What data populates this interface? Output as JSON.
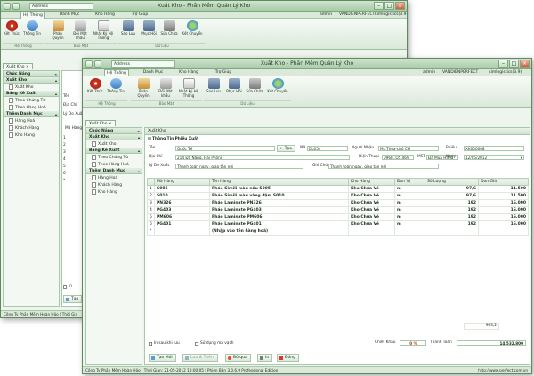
{
  "window": {
    "title": "Xuất Kho - Phần Mềm Quản Lý Kho",
    "address_label": "Address"
  },
  "menu": {
    "tabs": [
      "Hệ Thống",
      "Danh Mục",
      "Kho Hàng",
      "Trợ Giúp"
    ],
    "user": "admin",
    "machine": "VANDIENPERFECT",
    "company": "kimlogistics(3.9)"
  },
  "ribbon": {
    "system_buttons": [
      {
        "label": "Kết Thúc",
        "icon": "power-icon"
      },
      {
        "label": "Thông Tin",
        "icon": "info-icon"
      },
      {
        "label": "Phân Quyền",
        "icon": "users-icon"
      },
      {
        "label": "Đổi Mật khẩu",
        "icon": "password-icon"
      },
      {
        "label": "Nhật Ký Hệ Thống",
        "icon": "log-icon"
      }
    ],
    "data_buttons": [
      {
        "label": "Sao Lưu",
        "icon": "backup-icon"
      },
      {
        "label": "Phục Hồi",
        "icon": "restore-icon"
      },
      {
        "label": "Sửa Chữa",
        "icon": "repair-icon"
      },
      {
        "label": "Kết Chuyển",
        "icon": "transfer-icon"
      }
    ],
    "groups": [
      "Hệ Thống",
      "Bảo Mật",
      "Dữ Liệu"
    ]
  },
  "document_tab": "Xuất Kho",
  "sidebar": {
    "sections": [
      {
        "title": "Chức Năng",
        "items": []
      },
      {
        "title": "Xuất Kho",
        "items": [
          "Xuất Kho"
        ]
      },
      {
        "title": "Bảng Kê Xuất",
        "items": [
          "Theo Chứng Từ",
          "Theo Hàng Hoá"
        ]
      },
      {
        "title": "Thêm Danh Mục",
        "items": [
          "Hàng Hoá",
          "Khách Hàng",
          "Kho Hàng"
        ]
      }
    ]
  },
  "back_window": {
    "fields": [
      "Tên",
      "Địa Chỉ",
      "Lý Do Xuất"
    ],
    "grid_header": "Mã Hàng",
    "row_markers": [
      "1",
      "2",
      "3",
      "4",
      "5",
      "6",
      "*"
    ],
    "status_text": "Công Ty Phần Mềm Hoàn Hảo",
    "status_text2": "Thời Gia",
    "check_label": "In",
    "add_label": "Tạo"
  },
  "form": {
    "panel_title": "Xuất Kho",
    "section_title": "Thông Tin Phiếu Xuất",
    "ten_label": "Tên",
    "ten_value": "Quốc Tế",
    "add_button": "Tạo",
    "ma_label": "Mã",
    "ma_value": "DL054",
    "nguoi_nhan_label": "Người Nhận",
    "nguoi_nhan_value": "Ms.Thoa-chủ CH",
    "phieu_label": "Phiếu",
    "phieu_value": "XK000008",
    "dia_chi_label": "Địa Chỉ",
    "dia_chi_value": "214 Đà Nẵng, Hải Phòng",
    "dien_thoai_label": "Điện Thoại",
    "dien_thoai_value": "0968..Q5.469",
    "mst_label": "MST",
    "mst_value": "Đà Mua Hàng",
    "ngay_label": "Ngày",
    "ngay_value": "12/05/2012",
    "ly_do_label": "Lý Do Xuất",
    "ly_do_value": "Thanh toán ngay, giao tận nơi",
    "ghi_chu_label": "Ghi Chú",
    "ghi_chu_value": "Thanh toán ngay, giao tận nơi"
  },
  "grid": {
    "columns": [
      "Mã Hàng",
      "Tên Hàng",
      "Kho Hàng",
      "Đơn Vị",
      "Số Lượng",
      "Đơn Giá"
    ],
    "rows": [
      {
        "marker": "1",
        "code": "S005",
        "name": "Pháo Simili màu nâu S005",
        "warehouse": "Kho Chứa Vé",
        "unit": "m",
        "qty": "97,6",
        "price": "11.500"
      },
      {
        "marker": "2",
        "code": "S010",
        "name": "Pháo Simili màu vàng đậm S010",
        "warehouse": "Kho Chứa Vé",
        "unit": "m",
        "qty": "97,6",
        "price": "11.500"
      },
      {
        "marker": "3",
        "code": "PN326",
        "name": "Pháo Laminate PN326",
        "warehouse": "Kho Chứa Vé",
        "unit": "m",
        "qty": "192",
        "price": "16.000"
      },
      {
        "marker": "4",
        "code": "PG403",
        "name": "Pháo Laminate PG403",
        "warehouse": "Kho Chứa Vé",
        "unit": "m",
        "qty": "192",
        "price": "16.000"
      },
      {
        "marker": "5",
        "code": "PM606",
        "name": "Pháo Laminate PM606",
        "warehouse": "Kho Chứa Vé",
        "unit": "m",
        "qty": "192",
        "price": "16.000"
      },
      {
        "marker": "6",
        "code": "PG401",
        "name": "Pháo Laminate PG401",
        "warehouse": "Kho Chứa Vé",
        "unit": "m",
        "qty": "192",
        "price": "16.000"
      },
      {
        "marker": "*",
        "code": "",
        "name": "(Nhập vào tên hàng hoá)",
        "warehouse": "",
        "unit": "",
        "qty": "",
        "price": ""
      }
    ],
    "total_qty": "963,2"
  },
  "footer": {
    "check_print": "In sau khi lưu",
    "check_barcode": "Sử dụng mã vạch",
    "discount_label": "Chiết Khấu",
    "discount_value": "0 %",
    "total_label": "Thanh Toán",
    "total_value": "14.532.800",
    "buttons": [
      "Tạo Mới",
      "Lưu & Thêm",
      "Bỏ qua",
      "In",
      "Đóng"
    ]
  },
  "statusbar": {
    "company": "Công Ty Phần Mềm Hoàn Hảo",
    "time": "Thời Gian: 21-05-2012 10:00:05",
    "version": "Phiên Bản 3.0.6.9 Professional Edition",
    "website": "http://www.perfect.com.vn"
  }
}
